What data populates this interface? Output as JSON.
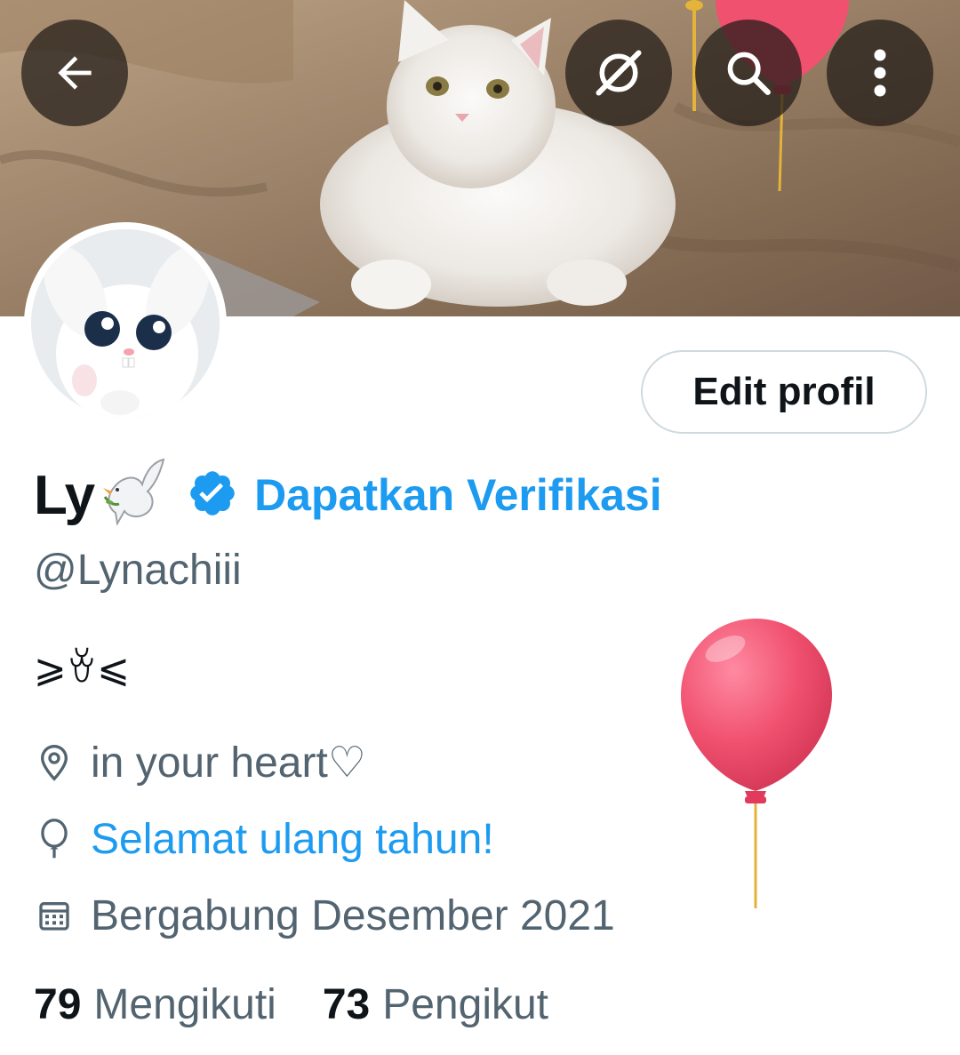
{
  "header": {
    "back_icon": "arrow-left-icon",
    "actions": [
      {
        "icon": "grok-icon"
      },
      {
        "icon": "search-icon"
      },
      {
        "icon": "more-vertical-icon"
      }
    ]
  },
  "profile": {
    "display_name": "Ly",
    "name_emoji": "dove-icon",
    "verified_badge": "verified-badge-icon",
    "get_verified_label": "Dapatkan Verifikasi",
    "handle": "@Lynachiii",
    "bio": "⩾ꈊ⩽",
    "edit_button_label": "Edit profil",
    "location": "in your heart♡",
    "birthday_text": "Selamat ulang tahun!",
    "joined": "Bergabung Desember 2021"
  },
  "stats": {
    "following_count": "79",
    "following_label": "Mengikuti",
    "followers_count": "73",
    "followers_label": "Pengikut"
  },
  "colors": {
    "accent": "#1d9bf0",
    "text_primary": "#0f1419",
    "text_secondary": "#536471",
    "balloon": "#f0516f"
  }
}
